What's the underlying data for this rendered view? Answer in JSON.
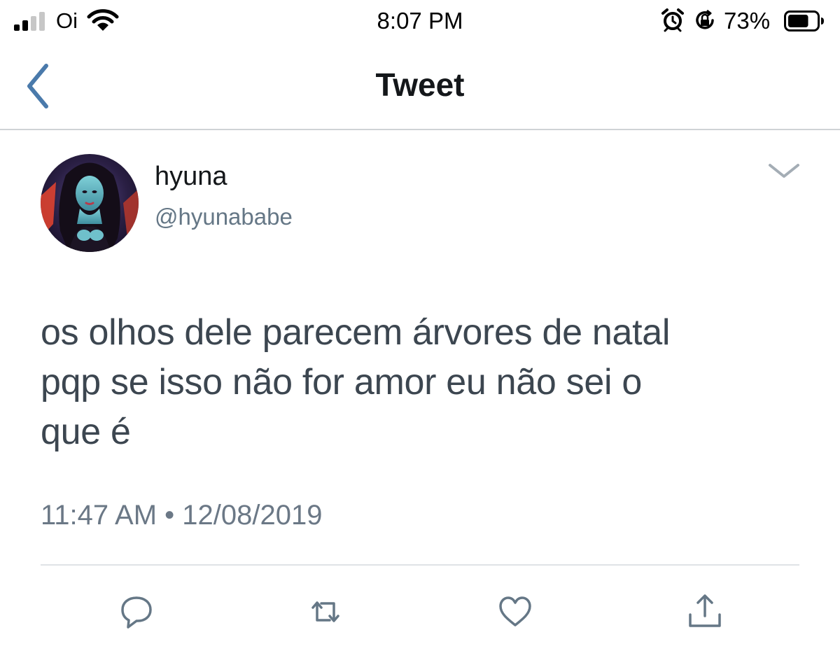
{
  "status_bar": {
    "carrier": "Oi",
    "signal_bars_filled": 2,
    "signal_bars_total": 4,
    "time": "8:07 PM",
    "battery_percent_label": "73%",
    "battery_level": 0.73,
    "icons": [
      "signal-icon",
      "wifi-icon",
      "alarm-icon",
      "orientation-lock-icon",
      "battery-icon"
    ]
  },
  "nav": {
    "title": "Tweet",
    "back_icon": "chevron-left-icon"
  },
  "tweet": {
    "display_name": "hyuna",
    "handle": "@hyunababe",
    "menu_icon": "chevron-down-icon",
    "text_lines": [
      "os olhos dele parecem árvores de natal",
      "pqp se isso não for amor eu não sei o",
      "que é"
    ],
    "timestamp": "11:47 AM • 12/08/2019"
  },
  "actions": [
    {
      "name": "reply",
      "icon": "reply-icon"
    },
    {
      "name": "retweet",
      "icon": "retweet-icon"
    },
    {
      "name": "like",
      "icon": "heart-icon"
    },
    {
      "name": "share",
      "icon": "share-icon"
    }
  ],
  "colors": {
    "accent": "#4a7aab",
    "text_primary": "#14171a",
    "text_secondary": "#657786",
    "tweet_text": "#3c4650",
    "divider": "#dfe3e6",
    "icon_gray": "#657786"
  }
}
